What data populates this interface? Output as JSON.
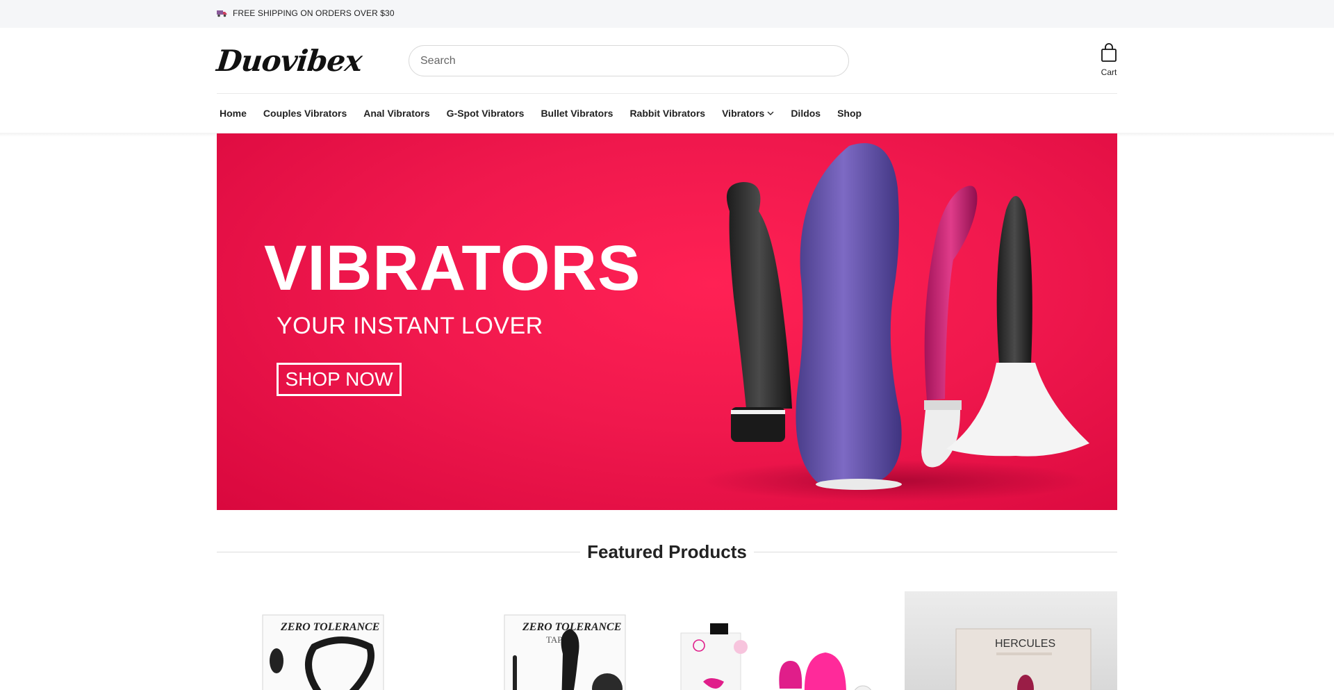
{
  "announcement": {
    "text": "FREE SHIPPING ON ORDERS OVER $30",
    "icon": "truck-icon"
  },
  "header": {
    "logo": "Duovibex",
    "search_placeholder": "Search",
    "cart_label": "Cart"
  },
  "nav": {
    "items": [
      {
        "label": "Home"
      },
      {
        "label": "Couples Vibrators"
      },
      {
        "label": "Anal Vibrators"
      },
      {
        "label": "G-Spot Vibrators"
      },
      {
        "label": "Bullet Vibrators"
      },
      {
        "label": "Rabbit Vibrators"
      },
      {
        "label": "Vibrators",
        "has_dropdown": true
      },
      {
        "label": "Dildos"
      },
      {
        "label": "Shop"
      }
    ]
  },
  "hero": {
    "title": "VIBRATORS",
    "subtitle": "YOUR INSTANT LOVER",
    "cta": "SHOP NOW",
    "background_color": "#f0184d"
  },
  "featured": {
    "title": "Featured Products",
    "products": [
      {
        "box_brand": "ZERO TOLERANCE"
      },
      {
        "box_brand": "ZERO TOLERANCE",
        "box_product": "TAP IT"
      },
      {
        "box_brand": ""
      },
      {
        "box_brand": "HERCULES"
      }
    ]
  },
  "colors": {
    "accent": "#f0184d",
    "text": "#1a1a1a",
    "announcement_bg": "#f5f6f8"
  }
}
